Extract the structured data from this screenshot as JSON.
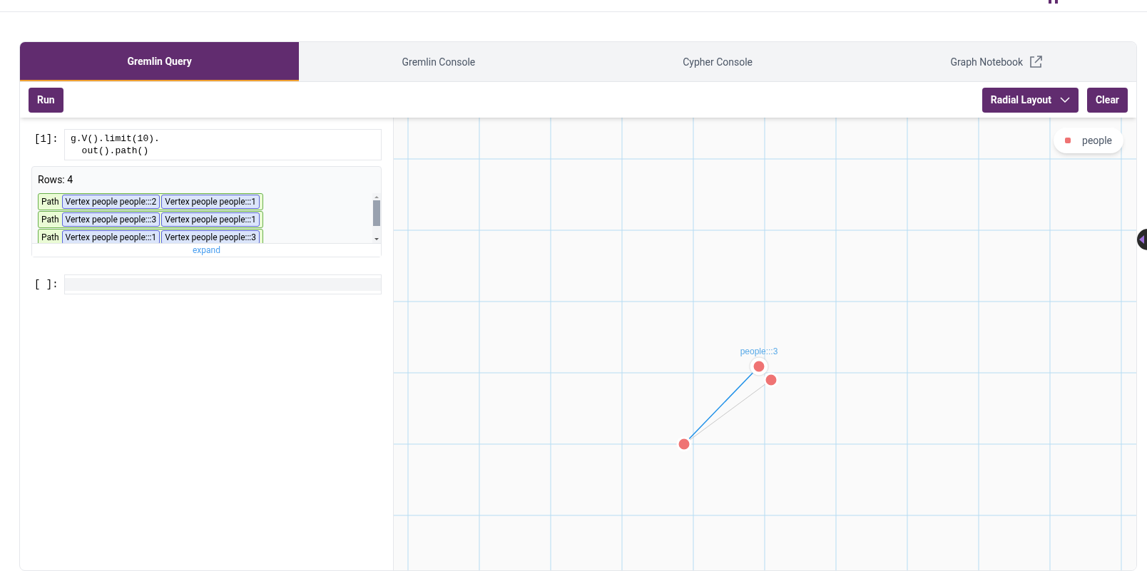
{
  "tabs": [
    {
      "label": "Gremlin Query",
      "selected": true,
      "external": false
    },
    {
      "label": "Gremlin Console",
      "selected": false,
      "external": false
    },
    {
      "label": "Cypher Console",
      "selected": false,
      "external": false
    },
    {
      "label": "Graph Notebook",
      "selected": false,
      "external": true
    }
  ],
  "toolbar": {
    "run": "Run",
    "layout": "Radial Layout",
    "clear": "Clear"
  },
  "cells": [
    {
      "prompt": "[1]:",
      "code": [
        "g.V().limit(10).",
        "  out().path()"
      ],
      "result": {
        "rows_label": "Rows: 4",
        "expand": "expand",
        "rows": [
          {
            "type": "Path",
            "vertices": [
              "Vertex people people:::2",
              "Vertex people people:::1"
            ]
          },
          {
            "type": "Path",
            "vertices": [
              "Vertex people people:::3",
              "Vertex people people:::1"
            ]
          },
          {
            "type": "Path",
            "vertices": [
              "Vertex people people:::1",
              "Vertex people people:::3"
            ]
          }
        ]
      }
    },
    {
      "prompt": "[ ]:"
    }
  ],
  "graph": {
    "legend": [
      {
        "label": "people",
        "color": "#ef7373"
      }
    ],
    "nodes": [
      {
        "label": "people:::3",
        "selected": true,
        "color": "#ef7373"
      },
      {
        "selected": false,
        "color": "#ef7373"
      },
      {
        "selected": false,
        "color": "#ef7373"
      }
    ],
    "edges": [
      {
        "highlighted": true
      },
      {
        "highlighted": false
      }
    ]
  }
}
